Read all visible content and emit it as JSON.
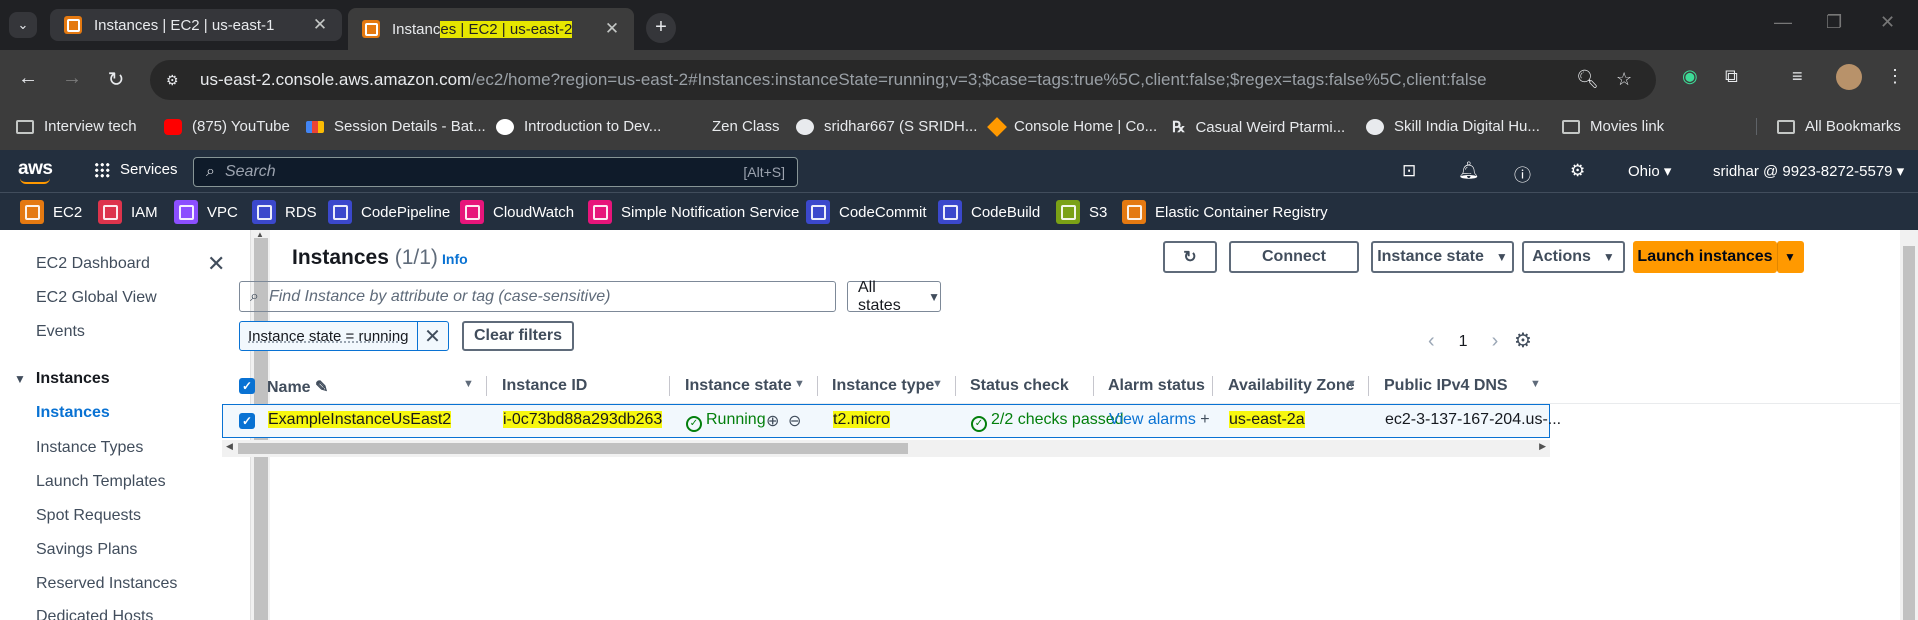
{
  "browser": {
    "tabs": [
      {
        "title": "Instances | EC2 | us-east-1",
        "active": false
      },
      {
        "title_plain": "Instanc",
        "title_hl": "es | EC2 | us-east-2",
        "active": true
      }
    ],
    "url_host": "us-east-2.console.aws.amazon.com",
    "url_path": "/ec2/home?region=us-east-2#Instances:instanceState=running;v=3;$case=tags:true%5C,client:false;$regex=tags:false%5C,client:false",
    "bookmarks": [
      {
        "label": "Interview tech",
        "icon": "folder-icon"
      },
      {
        "label": "(875) YouTube",
        "icon": "youtube-icon"
      },
      {
        "label": "Session Details - Bat...",
        "icon": "gmail-icon"
      },
      {
        "label": "Introduction to Dev...",
        "icon": "google-icon"
      },
      {
        "label": "Zen Class",
        "icon": "blank-icon"
      },
      {
        "label": "sridhar667 (S SRIDH...",
        "icon": "github-icon"
      },
      {
        "label": "Console Home | Co...",
        "icon": "aws-icon"
      },
      {
        "label": "Casual Weird Ptarmi...",
        "icon": "rx-icon"
      },
      {
        "label": "Skill India Digital Hu...",
        "icon": "skill-icon"
      },
      {
        "label": "Movies link",
        "icon": "folder-icon"
      }
    ],
    "all_bookmarks": "All Bookmarks"
  },
  "aws_header": {
    "logo": "aws",
    "services": "Services",
    "search_placeholder": "Search",
    "search_shortcut": "[Alt+S]",
    "region": "Ohio ▾",
    "account": "sridhar @ 9923-8272-5579 ▾"
  },
  "favorites": [
    {
      "label": "EC2",
      "color": "#e47911"
    },
    {
      "label": "IAM",
      "color": "#dd344c"
    },
    {
      "label": "VPC",
      "color": "#8c4fff"
    },
    {
      "label": "RDS",
      "color": "#3b48cc"
    },
    {
      "label": "CodePipeline",
      "color": "#3b48cc"
    },
    {
      "label": "CloudWatch",
      "color": "#e7157b"
    },
    {
      "label": "Simple Notification Service",
      "color": "#e7157b"
    },
    {
      "label": "CodeCommit",
      "color": "#3b48cc"
    },
    {
      "label": "CodeBuild",
      "color": "#3b48cc"
    },
    {
      "label": "S3",
      "color": "#7aa116"
    },
    {
      "label": "Elastic Container Registry",
      "color": "#e47911"
    }
  ],
  "sidenav": {
    "top_links": [
      "EC2 Dashboard",
      "EC2 Global View",
      "Events"
    ],
    "section": "Instances",
    "section_links": [
      "Instances",
      "Instance Types",
      "Launch Templates",
      "Spot Requests",
      "Savings Plans",
      "Reserved Instances",
      "Dedicated Hosts"
    ]
  },
  "panel": {
    "title": "Instances",
    "count": "(1/1)",
    "info": "Info",
    "buttons": {
      "connect": "Connect",
      "instance_state": "Instance state",
      "actions": "Actions",
      "launch": "Launch instances"
    },
    "filter_placeholder": "Find Instance by attribute or tag (case-sensitive)",
    "states_select": "All states",
    "token": "Instance state = running",
    "clear_filters": "Clear filters",
    "page": "1"
  },
  "table": {
    "columns": [
      "Name",
      "Instance ID",
      "Instance state",
      "Instance type",
      "Status check",
      "Alarm status",
      "Availability Zone",
      "Public IPv4 DNS"
    ],
    "rows": [
      {
        "name": "ExampleInstanceUsEast2",
        "instance_id": "i-0c73bd88a293db263",
        "state": "Running",
        "type": "t2.micro",
        "status_check": "2/2 checks passed",
        "alarm": "View alarms",
        "az": "us-east-2a",
        "dns": "ec2-3-137-167-204.us-..."
      }
    ]
  }
}
